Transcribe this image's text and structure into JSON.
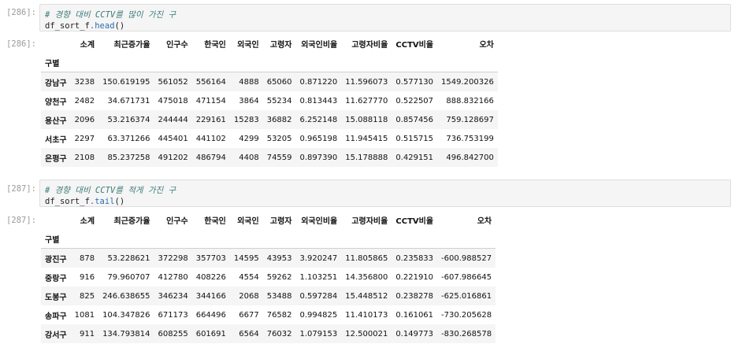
{
  "cell1": {
    "in_prompt": "[286]:",
    "comment": "# 경향 대비 CCTV를 많이 가진 구",
    "code_obj": "df_sort_f",
    "code_dot": ".",
    "code_method": "head",
    "code_tail": "()",
    "out_prompt": "[286]:",
    "columns": [
      "소계",
      "최근증가율",
      "인구수",
      "한국인",
      "외국인",
      "고령자",
      "외국인비율",
      "고령자비율",
      "CCTV비율",
      "오차"
    ],
    "index_name": "구별",
    "rows": [
      {
        "name": "강남구",
        "vals": [
          "3238",
          "150.619195",
          "561052",
          "556164",
          "4888",
          "65060",
          "0.871220",
          "11.596073",
          "0.577130",
          "1549.200326"
        ]
      },
      {
        "name": "양천구",
        "vals": [
          "2482",
          "34.671731",
          "475018",
          "471154",
          "3864",
          "55234",
          "0.813443",
          "11.627770",
          "0.522507",
          "888.832166"
        ]
      },
      {
        "name": "용산구",
        "vals": [
          "2096",
          "53.216374",
          "244444",
          "229161",
          "15283",
          "36882",
          "6.252148",
          "15.088118",
          "0.857456",
          "759.128697"
        ]
      },
      {
        "name": "서초구",
        "vals": [
          "2297",
          "63.371266",
          "445401",
          "441102",
          "4299",
          "53205",
          "0.965198",
          "11.945415",
          "0.515715",
          "736.753199"
        ]
      },
      {
        "name": "은평구",
        "vals": [
          "2108",
          "85.237258",
          "491202",
          "486794",
          "4408",
          "74559",
          "0.897390",
          "15.178888",
          "0.429151",
          "496.842700"
        ]
      }
    ]
  },
  "cell2": {
    "in_prompt": "[287]:",
    "comment": "# 경향 대비 CCTV를 적게 가진 구",
    "code_obj": "df_sort_f",
    "code_dot": ".",
    "code_method": "tail",
    "code_tail": "()",
    "out_prompt": "[287]:",
    "columns": [
      "소계",
      "최근증가율",
      "인구수",
      "한국인",
      "외국인",
      "고령자",
      "외국인비율",
      "고령자비율",
      "CCTV비율",
      "오차"
    ],
    "index_name": "구별",
    "rows": [
      {
        "name": "광진구",
        "vals": [
          "878",
          "53.228621",
          "372298",
          "357703",
          "14595",
          "43953",
          "3.920247",
          "11.805865",
          "0.235833",
          "-600.988527"
        ]
      },
      {
        "name": "중랑구",
        "vals": [
          "916",
          "79.960707",
          "412780",
          "408226",
          "4554",
          "59262",
          "1.103251",
          "14.356800",
          "0.221910",
          "-607.986645"
        ]
      },
      {
        "name": "도봉구",
        "vals": [
          "825",
          "246.638655",
          "346234",
          "344166",
          "2068",
          "53488",
          "0.597284",
          "15.448512",
          "0.238278",
          "-625.016861"
        ]
      },
      {
        "name": "송파구",
        "vals": [
          "1081",
          "104.347826",
          "671173",
          "664496",
          "6677",
          "76582",
          "0.994825",
          "11.410173",
          "0.161061",
          "-730.205628"
        ]
      },
      {
        "name": "강서구",
        "vals": [
          "911",
          "134.793814",
          "608255",
          "601691",
          "6564",
          "76032",
          "1.079153",
          "12.500021",
          "0.149773",
          "-830.268578"
        ]
      }
    ]
  }
}
